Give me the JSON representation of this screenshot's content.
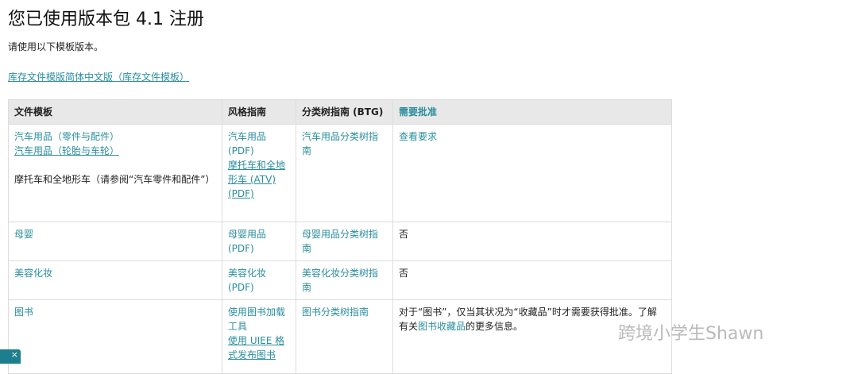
{
  "title": "您已使用版本包 4.1 注册",
  "intro": "请使用以下模板版本。",
  "top_link": "库存文件模版简体中文版（库存文件模板）",
  "headers": [
    "文件模板",
    "风格指南",
    "分类树指南 (BTG)",
    "需要批准"
  ],
  "rows": [
    {
      "t1": "汽车用品（零件与配件）",
      "t2": "汽车用品（轮胎与车轮）",
      "t3": "摩托车和全地形车（请参阅“汽车零件和配件”）",
      "s1": "汽车用品 (PDF)",
      "s2": "摩托车和全地形车 (ATV) (PDF)",
      "btg": "汽车用品分类树指南",
      "appr": "查看要求"
    },
    {
      "t1": "母婴",
      "s1": "母婴用品 (PDF)",
      "btg": "母婴用品分类树指南",
      "appr": "否"
    },
    {
      "t1": "美容化妆",
      "s1": "美容化妆 (PDF)",
      "btg": "美容化妆分类树指南",
      "appr": "否"
    },
    {
      "t1": "图书",
      "s1": "使用图书加载工具",
      "s2": "使用 UIEE 格式发布图书",
      "btg": "图书分类树指南",
      "appr_a": "对于“图书”，仅当其状况为“收藏品”时才需要获得批准。了解有关",
      "appr_link": "图书收藏品",
      "appr_b": "的更多信息。"
    }
  ],
  "watermark": "跨境小学生Shawn",
  "close_label": "×"
}
